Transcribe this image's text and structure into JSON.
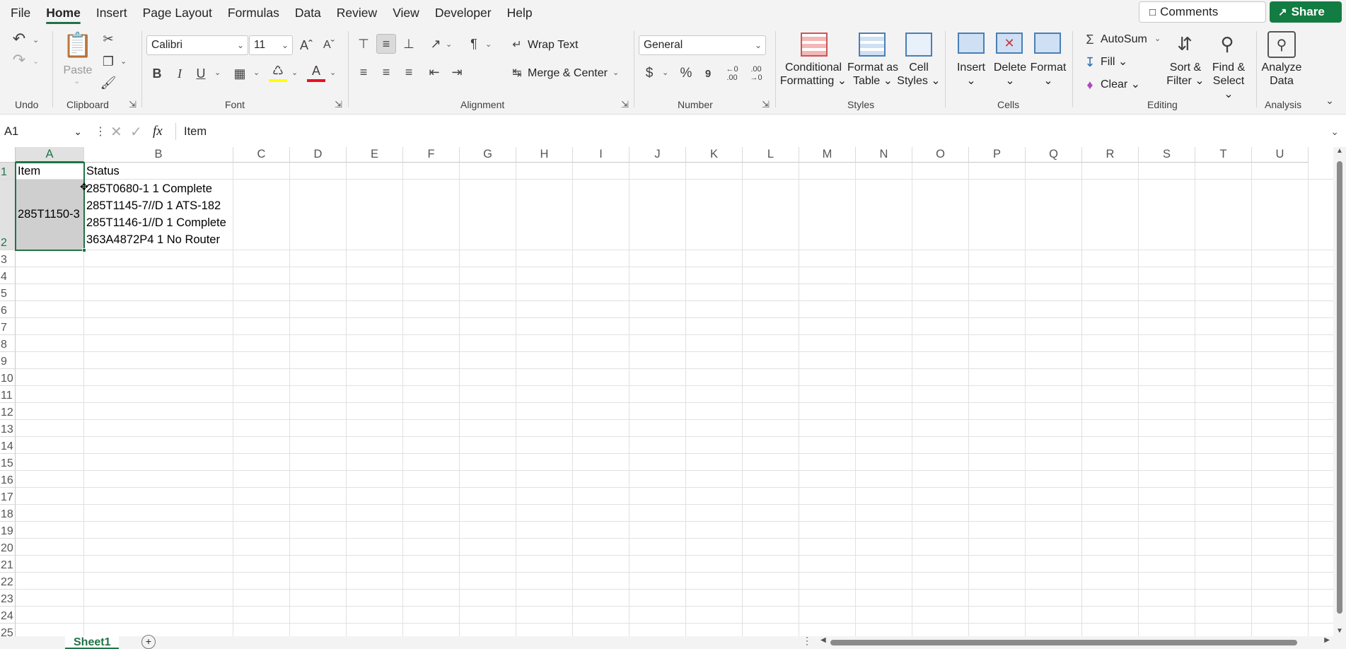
{
  "menu": {
    "tabs": [
      "File",
      "Home",
      "Insert",
      "Page Layout",
      "Formulas",
      "Data",
      "Review",
      "View",
      "Developer",
      "Help"
    ],
    "active": "Home",
    "comments": "Comments",
    "share": "Share"
  },
  "ribbon": {
    "undo": {
      "label": "Undo"
    },
    "clipboard": {
      "label": "Clipboard",
      "paste": "Paste"
    },
    "font": {
      "label": "Font",
      "name": "Calibri",
      "size": "11",
      "bold": "B",
      "italic": "I",
      "underline": "U"
    },
    "alignment": {
      "label": "Alignment",
      "wrap": "Wrap Text",
      "merge": "Merge & Center"
    },
    "number": {
      "label": "Number",
      "format": "General",
      "currency": "$",
      "percent": "%",
      "comma": "9",
      "inc": "←0 .00",
      "dec": ".00 →0"
    },
    "styles": {
      "label": "Styles",
      "cond1": "Conditional",
      "cond2": "Formatting",
      "fat1": "Format as",
      "fat2": "Table",
      "cs1": "Cell",
      "cs2": "Styles"
    },
    "cells": {
      "label": "Cells",
      "insert": "Insert",
      "delete": "Delete",
      "format": "Format"
    },
    "editing": {
      "label": "Editing",
      "autosum": "AutoSum",
      "fill": "Fill",
      "clear": "Clear",
      "sort1": "Sort &",
      "sort2": "Filter",
      "find1": "Find &",
      "find2": "Select"
    },
    "analysis": {
      "label": "Analysis",
      "a1": "Analyze",
      "a2": "Data"
    }
  },
  "formula_bar": {
    "cell_ref": "A1",
    "fx": "fx",
    "content": "Item"
  },
  "sheet": {
    "columns": [
      "A",
      "B",
      "C",
      "D",
      "E",
      "F",
      "G",
      "H",
      "I",
      "J",
      "K",
      "L",
      "M",
      "N",
      "O",
      "P",
      "Q",
      "R",
      "S",
      "T",
      "U"
    ],
    "rows": [
      "1",
      "2",
      "3",
      "4",
      "5",
      "6",
      "7",
      "8",
      "9",
      "10",
      "11",
      "12",
      "13",
      "14",
      "15",
      "16",
      "17",
      "18",
      "19",
      "20",
      "21",
      "22",
      "23",
      "24",
      "25"
    ],
    "cells": {
      "A1": "Item",
      "B1": "Status",
      "A2": "285T1150-3",
      "B2": [
        "285T0680-1 1 Complete",
        "285T1145-7//D 1 ATS-182",
        "285T1146-1//D 1 Complete",
        "363A4872P4 1 No Router"
      ]
    }
  },
  "sheet_tabs": [
    "Sheet1"
  ]
}
